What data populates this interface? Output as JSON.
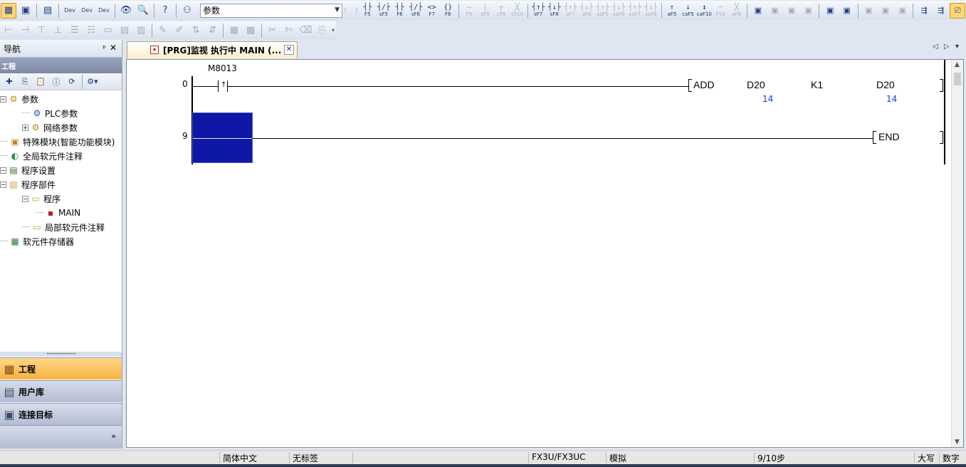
{
  "toolbar": {
    "combo_value": "参数",
    "left_buttons": [
      "project-icon",
      "module-icon",
      "window-icon",
      "dev-icon",
      "dev-icon",
      "dev-icon",
      "watch-icon",
      "find-icon",
      "help-icon",
      "binoculars-icon"
    ],
    "fkeys_row": [
      {
        "sym": "┤├",
        "lab": "F5",
        "dim": false
      },
      {
        "sym": "┤/├",
        "lab": "sF5",
        "dim": false
      },
      {
        "sym": "┤├",
        "lab": "F6",
        "dim": false
      },
      {
        "sym": "┤/├",
        "lab": "sF6",
        "dim": false
      },
      {
        "sym": "<>",
        "lab": "F7",
        "dim": false
      },
      {
        "sym": "{}",
        "lab": "F8",
        "dim": false
      },
      {
        "sym": "—",
        "lab": "F9",
        "dim": true
      },
      {
        "sym": "|",
        "lab": "sF9",
        "dim": true
      },
      {
        "sym": "┬",
        "lab": "cF9",
        "dim": true
      },
      {
        "sym": "╳",
        "lab": "cF10",
        "dim": true
      },
      {
        "sym": "┤↑├",
        "lab": "sF7",
        "dim": false
      },
      {
        "sym": "┤↓├",
        "lab": "sF8",
        "dim": false
      },
      {
        "sym": "┤↑├",
        "lab": "aF7",
        "dim": true
      },
      {
        "sym": "┤↓├",
        "lab": "aF8",
        "dim": true
      },
      {
        "sym": "┤↑├",
        "lab": "saF5",
        "dim": true
      },
      {
        "sym": "┤↓├",
        "lab": "saF6",
        "dim": true
      },
      {
        "sym": "┤↑├",
        "lab": "saF7",
        "dim": true
      },
      {
        "sym": "┤↓├",
        "lab": "saF8",
        "dim": true
      },
      {
        "sym": "↑",
        "lab": "aF5",
        "dim": false
      },
      {
        "sym": "↓",
        "lab": "caF5",
        "dim": false
      },
      {
        "sym": "↕",
        "lab": "caF10",
        "dim": false
      },
      {
        "sym": "─",
        "lab": "F10",
        "dim": true
      },
      {
        "sym": "╳",
        "lab": "aF9",
        "dim": true
      }
    ]
  },
  "nav": {
    "title": "导航",
    "pin": "ᵖ",
    "close": "✕",
    "section": "工程",
    "tree": [
      {
        "label": "参数",
        "level": 0,
        "exp": "−",
        "icon": "params-icon"
      },
      {
        "label": "PLC参数",
        "level": 1,
        "exp": "",
        "icon": "plc-params-icon"
      },
      {
        "label": "网络参数",
        "level": 1,
        "exp": "+",
        "icon": "network-params-icon"
      },
      {
        "label": "特殊模块(智能功能模块)",
        "level": 0,
        "exp": "",
        "icon": "special-module-icon"
      },
      {
        "label": "全局软元件注释",
        "level": 0,
        "exp": "",
        "icon": "global-comment-icon"
      },
      {
        "label": "程序设置",
        "level": 0,
        "exp": "−",
        "icon": "program-settings-icon"
      },
      {
        "label": "程序部件",
        "level": 0,
        "exp": "−",
        "icon": "program-parts-icon"
      },
      {
        "label": "程序",
        "level": 1,
        "exp": "−",
        "icon": "program-folder-icon"
      },
      {
        "label": "MAIN",
        "level": 2,
        "exp": "",
        "icon": "ladder-doc-icon"
      },
      {
        "label": "局部软元件注释",
        "level": 1,
        "exp": "",
        "icon": "local-comment-icon"
      },
      {
        "label": "软元件存储器",
        "level": 0,
        "exp": "",
        "icon": "device-memory-icon"
      }
    ],
    "buttons": [
      {
        "label": "工程",
        "active": true
      },
      {
        "label": "用户库",
        "active": false
      },
      {
        "label": "连接目标",
        "active": false
      }
    ],
    "more": "»"
  },
  "doc_tab": {
    "title": "[PRG]监视 执行中 MAIN (...",
    "close": "✕",
    "prev": "◁",
    "next": "▷",
    "menu": "▾"
  },
  "ladder": {
    "rungs": [
      {
        "step": "0",
        "contact_device": "M8013",
        "contact_symbol": "↑",
        "instruction": "ADD",
        "operands": [
          "D20",
          "K1",
          "D20"
        ],
        "monitor_values": [
          "14",
          "",
          "14"
        ]
      },
      {
        "step": "9",
        "instruction": "END"
      }
    ]
  },
  "statusbar": {
    "language": "简体中文",
    "label": "无标签",
    "cpu": "FX3U/FX3UC",
    "mode": "模拟",
    "steps": "9/10步",
    "caps": "大写",
    "num": "数字"
  },
  "colors": {
    "cursor": "#0e17a6",
    "monitor_value": "#1a3adb",
    "active_nav_button": "#f6b340"
  }
}
